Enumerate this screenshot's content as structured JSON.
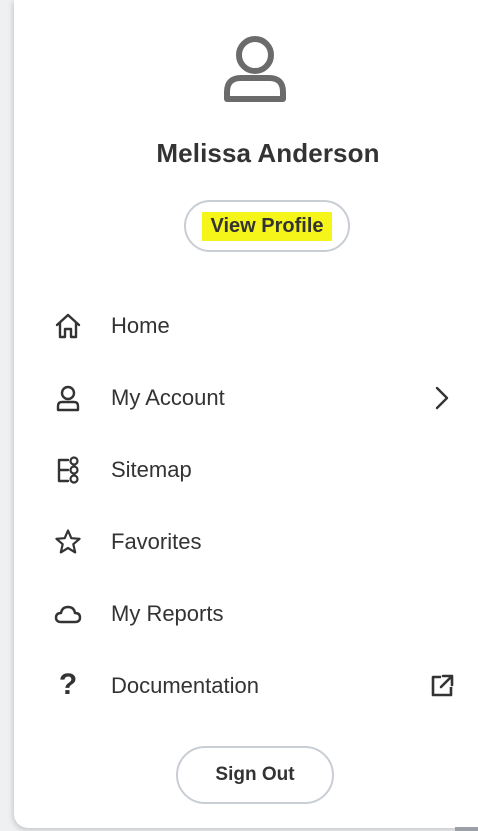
{
  "user": {
    "name": "Melissa Anderson",
    "view_profile_label": "View Profile"
  },
  "menu": {
    "items": [
      {
        "label": "Home",
        "icon": "home-icon"
      },
      {
        "label": "My Account",
        "icon": "person-icon",
        "trailing": "chevron-right-icon"
      },
      {
        "label": "Sitemap",
        "icon": "sitemap-icon"
      },
      {
        "label": "Favorites",
        "icon": "star-icon"
      },
      {
        "label": "My Reports",
        "icon": "cloud-icon"
      },
      {
        "label": "Documentation",
        "icon": "question-icon",
        "trailing": "external-link-icon"
      }
    ]
  },
  "sign_out_label": "Sign Out",
  "colors": {
    "text": "#333333",
    "highlight": "#f5f519",
    "icon_gray": "#6b6b6b",
    "border": "#c9ced4"
  }
}
